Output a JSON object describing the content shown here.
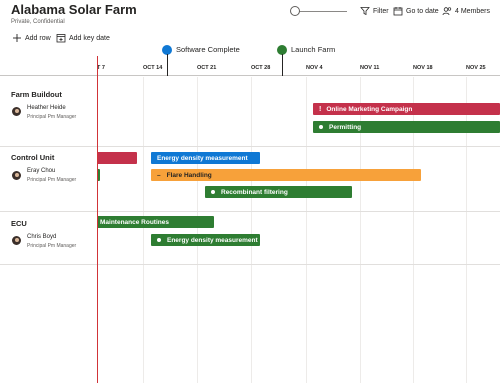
{
  "header": {
    "title": "Alabama Solar Farm",
    "subtitle": "Private, Confidential"
  },
  "toolbar": {
    "filter_label": "Filter",
    "goto_label": "Go to date",
    "members_label": "4 Members"
  },
  "actions": {
    "add_row": "Add row",
    "add_key_date": "Add key date"
  },
  "timeline": {
    "milestones": [
      {
        "label": "Software Complete",
        "color": "#0f78d4"
      },
      {
        "label": "Launch Farm",
        "color": "#2e7d32"
      }
    ],
    "dates": [
      "T 7",
      "OCT 14",
      "OCT 21",
      "OCT 28",
      "NOV 4",
      "NOV 11",
      "NOV 18",
      "NOV 25"
    ]
  },
  "groups": [
    {
      "name": "Farm Buildout",
      "person": "Heather Heide",
      "role": "Principal Pm Manager",
      "bars": [
        {
          "label": "Online Marketing Campaign",
          "color": "red",
          "icon": "!"
        },
        {
          "label": "Permitting",
          "color": "green",
          "icon": "dot"
        }
      ]
    },
    {
      "name": "Control Unit",
      "person": "Eray Chou",
      "role": "Principal Pm Manager",
      "bars": [
        {
          "label": "",
          "color": "red",
          "icon": ""
        },
        {
          "label": "Energy density measurement",
          "color": "blue",
          "icon": ""
        },
        {
          "label": "",
          "color": "green",
          "icon": ""
        },
        {
          "label": "Flare Handling",
          "color": "orange",
          "icon": "dash"
        },
        {
          "label": "Recombinant filtering",
          "color": "green",
          "icon": "dot"
        }
      ]
    },
    {
      "name": "ECU",
      "person": "Chris Boyd",
      "role": "Principal Pm Manager",
      "bars": [
        {
          "label": "Maintenance Routines",
          "color": "green",
          "icon": ""
        },
        {
          "label": "Energy density measurement",
          "color": "green",
          "icon": "dot"
        }
      ]
    }
  ],
  "colors": {
    "today_line": "#d13438",
    "red": "#c4314b",
    "green": "#2e7d32",
    "blue": "#0f78d4",
    "orange": "#f7a13a"
  }
}
